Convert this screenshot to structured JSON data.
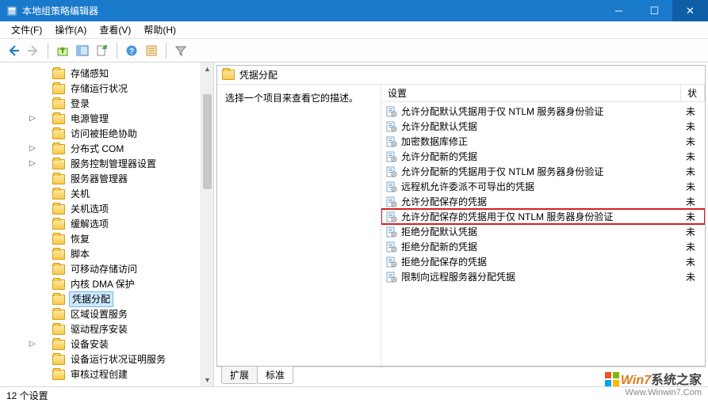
{
  "window": {
    "title": "本地组策略编辑器"
  },
  "menus": {
    "file": "文件(F)",
    "action": "操作(A)",
    "view": "查看(V)",
    "help": "帮助(H)"
  },
  "tree": {
    "items": [
      {
        "label": "存储感知",
        "expandable": false
      },
      {
        "label": "存储运行状况",
        "expandable": false
      },
      {
        "label": "登录",
        "expandable": false
      },
      {
        "label": "电源管理",
        "expandable": true
      },
      {
        "label": "访问被拒绝协助",
        "expandable": false
      },
      {
        "label": "分布式 COM",
        "expandable": true
      },
      {
        "label": "服务控制管理器设置",
        "expandable": true
      },
      {
        "label": "服务器管理器",
        "expandable": false
      },
      {
        "label": "关机",
        "expandable": false
      },
      {
        "label": "关机选项",
        "expandable": false
      },
      {
        "label": "缓解选项",
        "expandable": false
      },
      {
        "label": "恢复",
        "expandable": false
      },
      {
        "label": "脚本",
        "expandable": false
      },
      {
        "label": "可移动存储访问",
        "expandable": false
      },
      {
        "label": "内核 DMA 保护",
        "expandable": false
      },
      {
        "label": "凭据分配",
        "expandable": false,
        "selected": true
      },
      {
        "label": "区域设置服务",
        "expandable": false
      },
      {
        "label": "驱动程序安装",
        "expandable": false
      },
      {
        "label": "设备安装",
        "expandable": true
      },
      {
        "label": "设备运行状况证明服务",
        "expandable": false
      },
      {
        "label": "审核过程创建",
        "expandable": false
      }
    ]
  },
  "header": {
    "title": "凭据分配"
  },
  "description": {
    "text": "选择一个项目来查看它的描述。"
  },
  "columns": {
    "settings": "设置",
    "status": "状"
  },
  "policies": [
    {
      "label": "允许分配默认凭据用于仅 NTLM 服务器身份验证",
      "status": "未"
    },
    {
      "label": "允许分配默认凭据",
      "status": "未"
    },
    {
      "label": "加密数据库修正",
      "status": "未"
    },
    {
      "label": "允许分配新的凭据",
      "status": "未"
    },
    {
      "label": "允许分配新的凭据用于仅 NTLM 服务器身份验证",
      "status": "未"
    },
    {
      "label": "远程机允许委派不可导出的凭据",
      "status": "未"
    },
    {
      "label": "允许分配保存的凭据",
      "status": "未"
    },
    {
      "label": "允许分配保存的凭据用于仅 NTLM 服务器身份验证",
      "status": "未",
      "highlight": true
    },
    {
      "label": "拒绝分配默认凭据",
      "status": "未"
    },
    {
      "label": "拒绝分配新的凭据",
      "status": "未"
    },
    {
      "label": "拒绝分配保存的凭据",
      "status": "未"
    },
    {
      "label": "限制向远程服务器分配凭据",
      "status": "未"
    }
  ],
  "tabs": {
    "extended": "扩展",
    "standard": "标准"
  },
  "status": {
    "count": "12 个设置"
  },
  "watermark": {
    "line1a": "Win7",
    "line1b": "系统之家",
    "line2": "Www.Winwin7.Com"
  }
}
